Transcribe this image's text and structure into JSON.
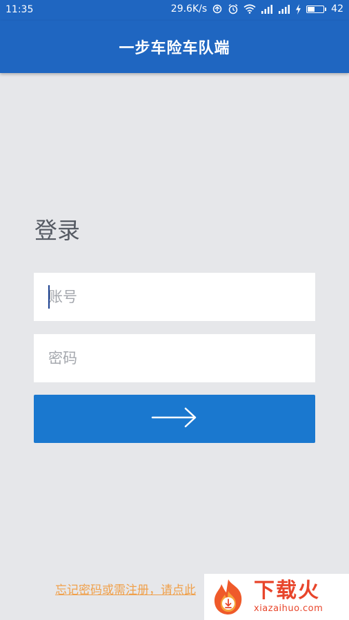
{
  "status_bar": {
    "time": "11:35",
    "network_speed": "29.6K/s",
    "battery_level": "42",
    "battery_fraction": 0.42
  },
  "app_bar": {
    "title": "一步车险车队端"
  },
  "login": {
    "title": "登录",
    "account_placeholder": "账号",
    "account_value": "",
    "password_placeholder": "密码",
    "password_value": "",
    "submit_icon": "arrow-right-icon",
    "forgot_link_text": "忘记密码或需注册，请点此"
  },
  "watermark": {
    "title": "下载火",
    "url": "xiazaihuo.com"
  },
  "colors": {
    "primary": "#1f66c1",
    "button": "#1a78cf",
    "background": "#e6e7ea",
    "link": "#f0a04a",
    "watermark": "#e8452b"
  }
}
